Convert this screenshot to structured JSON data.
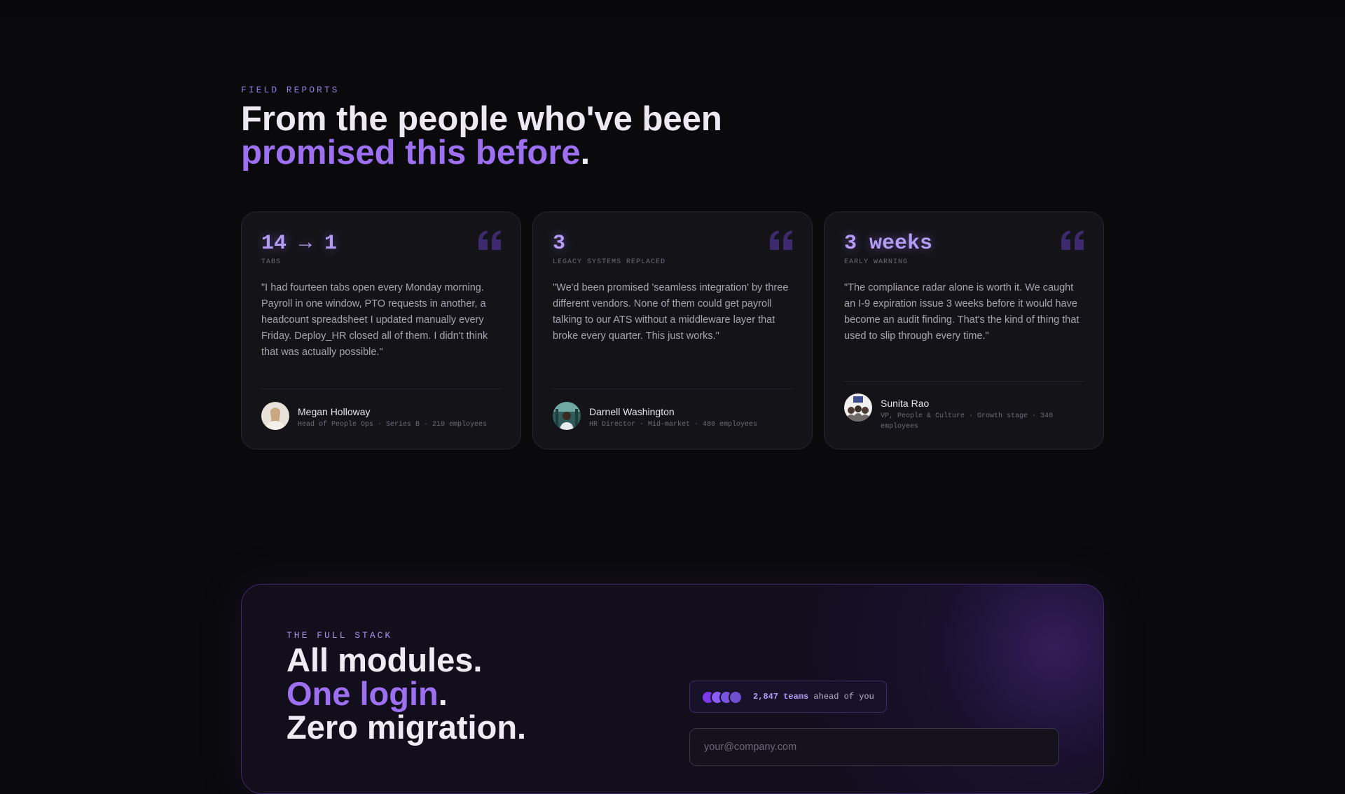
{
  "testimonials": {
    "eyebrow": "FIELD REPORTS",
    "heading_line1": "From the people who've been",
    "heading_accent": "promised this before",
    "heading_period": ".",
    "cards": [
      {
        "stat": "14 → 1",
        "stat_label": "TABS",
        "quote": "\"I had fourteen tabs open every Monday morning. Payroll in one window, PTO requests in another, a headcount spreadsheet I updated manually every Friday. Deploy_HR closed all of them. I didn't think that was actually possible.\"",
        "name": "Megan Holloway",
        "role": "Head of People Ops · Series B · 210 employees"
      },
      {
        "stat": "3",
        "stat_label": "LEGACY SYSTEMS REPLACED",
        "quote": "\"We'd been promised 'seamless integration' by three different vendors. None of them could get payroll talking to our ATS without a middleware layer that broke every quarter. This just works.\"",
        "name": "Darnell Washington",
        "role": "HR Director · Mid-market · 480 employees"
      },
      {
        "stat": "3 weeks",
        "stat_label": "EARLY WARNING",
        "quote": "\"The compliance radar alone is worth it. We caught an I-9 expiration issue 3 weeks before it would have become an audit finding. That's the kind of thing that used to slip through every time.\"",
        "name": "Sunita Rao",
        "role": "VP, People & Culture · Growth stage · 340 employees"
      }
    ]
  },
  "cta": {
    "eyebrow": "THE FULL STACK",
    "line1": "All modules.",
    "line2_accent": "One login",
    "line2_period": ".",
    "line3": "Zero migration.",
    "teams_count": "2,847 teams",
    "teams_suffix": " ahead of you",
    "email_placeholder": "your@company.com"
  },
  "colors": {
    "accent": "#9d70f2",
    "background": "#0a0a0c",
    "card": "#141418"
  },
  "icons": [
    "quote-icon",
    "avatar"
  ]
}
